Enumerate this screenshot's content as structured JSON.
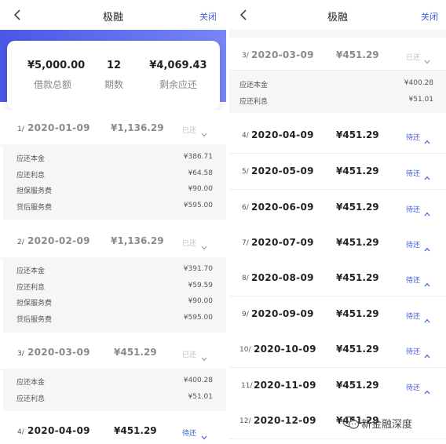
{
  "header": {
    "title": "极融",
    "close_label": "关闭"
  },
  "summary": {
    "total_amount": "¥5,000.00",
    "total_amount_label": "借款总额",
    "periods": "12",
    "periods_label": "期数",
    "remaining": "¥4,069.43",
    "remaining_label": "剩余应还"
  },
  "labels": {
    "principal": "应还本金",
    "interest": "应还利息",
    "guarantee_fee": "担保服务费",
    "after_loan_fee": "贷后服务费",
    "paid": "已还",
    "pending": "待还"
  },
  "installments": [
    {
      "num": "1/",
      "date": "2020-01-09",
      "amount": "¥1,136.29",
      "principal": "¥386.71",
      "interest": "¥64.58",
      "guarantee_fee": "¥90.00",
      "after_loan_fee": "¥595.00"
    },
    {
      "num": "2/",
      "date": "2020-02-09",
      "amount": "¥1,136.29",
      "principal": "¥391.70",
      "interest": "¥59.59",
      "guarantee_fee": "¥90.00",
      "after_loan_fee": "¥595.00"
    },
    {
      "num": "3/",
      "date": "2020-03-09",
      "amount": "¥451.29",
      "principal": "¥400.28",
      "interest": "¥51.01"
    },
    {
      "num": "4/",
      "date": "2020-04-09",
      "amount": "¥451.29"
    },
    {
      "num": "5/",
      "date": "2020-05-09",
      "amount": "¥451.29"
    },
    {
      "num": "6/",
      "date": "2020-06-09",
      "amount": "¥451.29"
    },
    {
      "num": "7/",
      "date": "2020-07-09",
      "amount": "¥451.29"
    },
    {
      "num": "8/",
      "date": "2020-08-09",
      "amount": "¥451.29"
    },
    {
      "num": "9/",
      "date": "2020-09-09",
      "amount": "¥451.29"
    },
    {
      "num": "10/",
      "date": "2020-10-09",
      "amount": "¥451.29"
    },
    {
      "num": "11/",
      "date": "2020-11-09",
      "amount": "¥451.29"
    },
    {
      "num": "12/",
      "date": "2020-12-09",
      "amount": "¥451.29"
    }
  ],
  "watermark": {
    "text": "新金融深度",
    "icon": "wechat-icon"
  },
  "colors": {
    "accent": "#3f5bd9",
    "hero_start": "#4b57e6",
    "hero_end": "#7886f6"
  }
}
